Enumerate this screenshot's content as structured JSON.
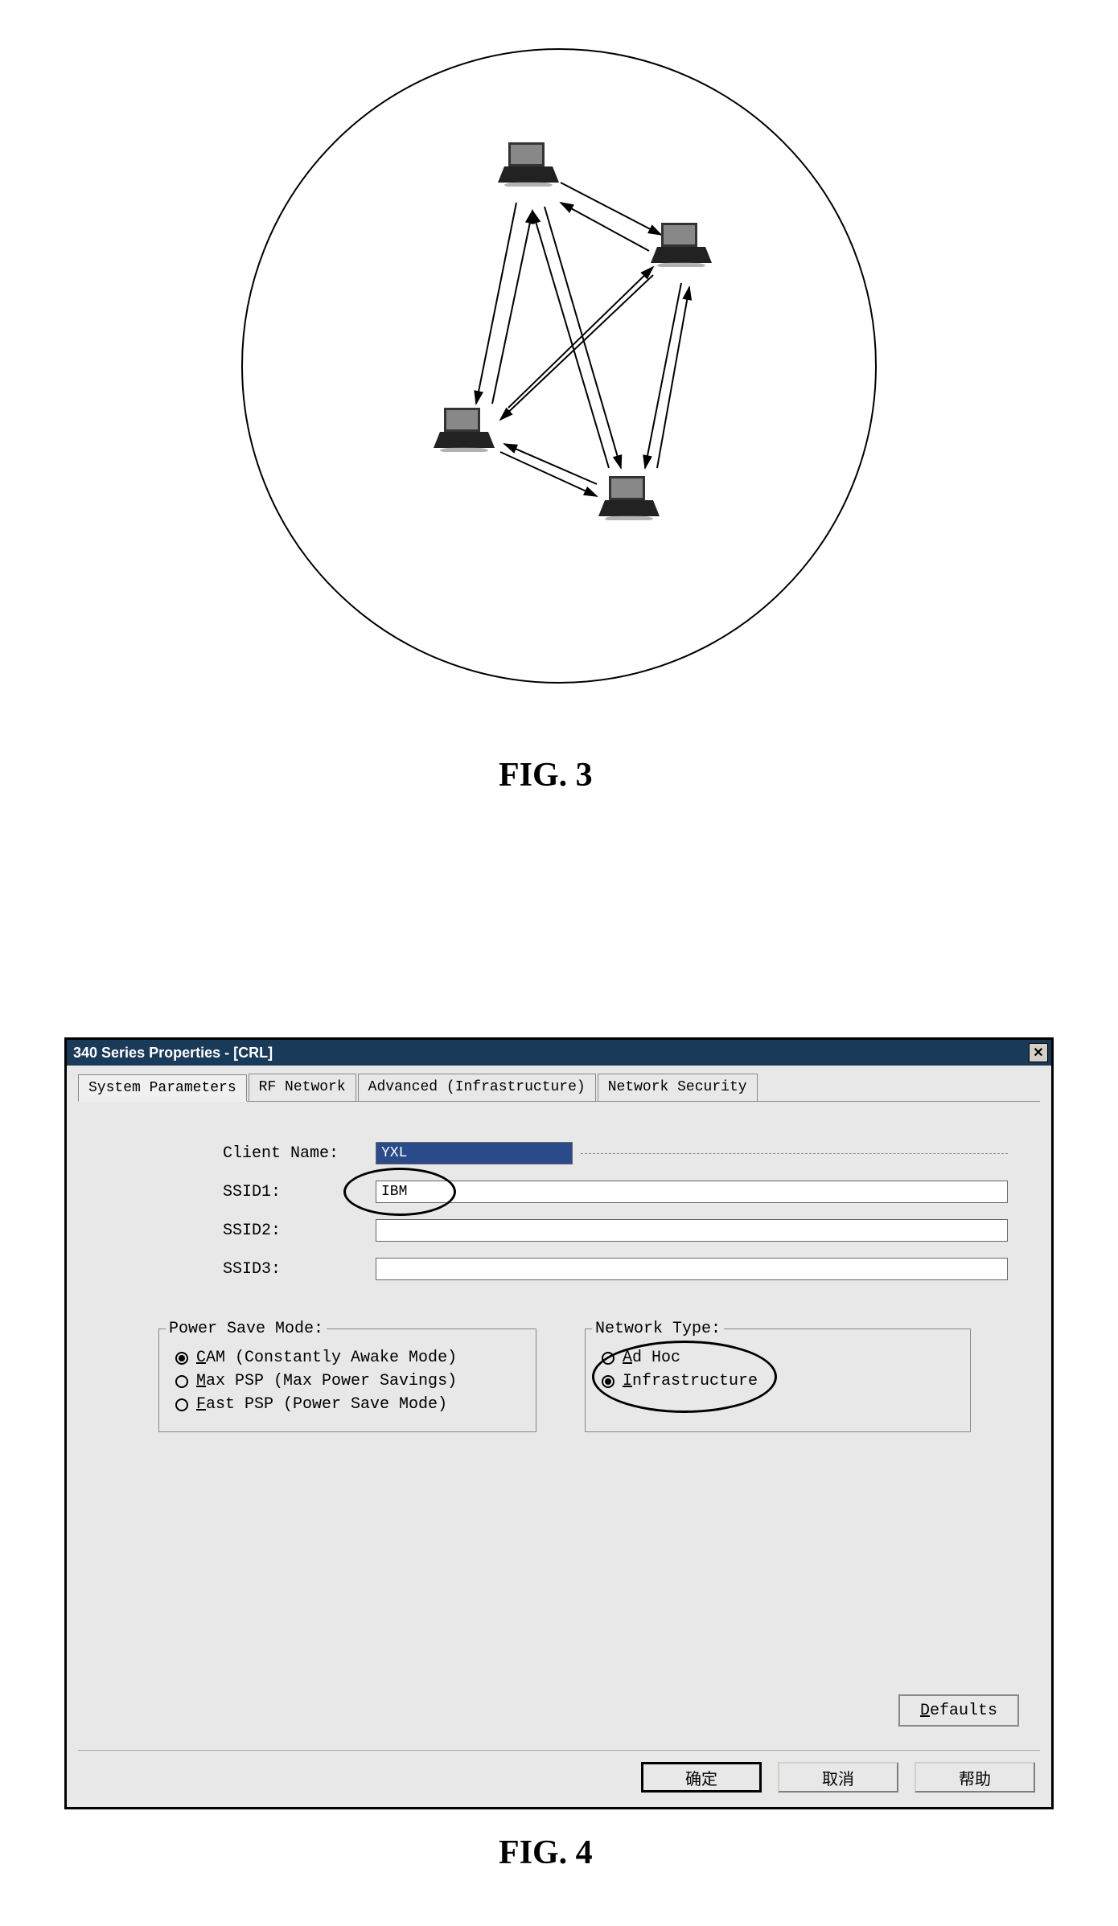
{
  "fig3": {
    "caption": "FIG. 3"
  },
  "fig4": {
    "caption": "FIG. 4",
    "title": "340 Series Properties - [CRL]",
    "tabs": [
      "System Parameters",
      "RF Network",
      "Advanced (Infrastructure)",
      "Network Security"
    ],
    "fields": {
      "client_name_label": "Client Name:",
      "client_name_value": "YXL",
      "ssid1_label": "SSID1:",
      "ssid1_value": "IBM",
      "ssid2_label": "SSID2:",
      "ssid2_value": "",
      "ssid3_label": "SSID3:",
      "ssid3_value": ""
    },
    "power_save": {
      "title": "Power Save Mode:",
      "options": [
        {
          "label_pre": "C",
          "label_rest": "AM (Constantly Awake Mode)",
          "checked": true
        },
        {
          "label_pre": "M",
          "label_rest": "ax PSP (Max Power Savings)",
          "checked": false
        },
        {
          "label_pre": "F",
          "label_rest": "ast PSP (Power Save Mode)",
          "checked": false
        }
      ]
    },
    "network_type": {
      "title": "Network Type:",
      "options": [
        {
          "label_pre": "A",
          "label_rest": "d Hoc",
          "checked": false
        },
        {
          "label_pre": "I",
          "label_rest": "nfrastructure",
          "checked": true
        }
      ]
    },
    "defaults_label_pre": "D",
    "defaults_label_rest": "efaults",
    "buttons": {
      "ok": "确定",
      "cancel": "取消",
      "help": "帮助"
    }
  }
}
